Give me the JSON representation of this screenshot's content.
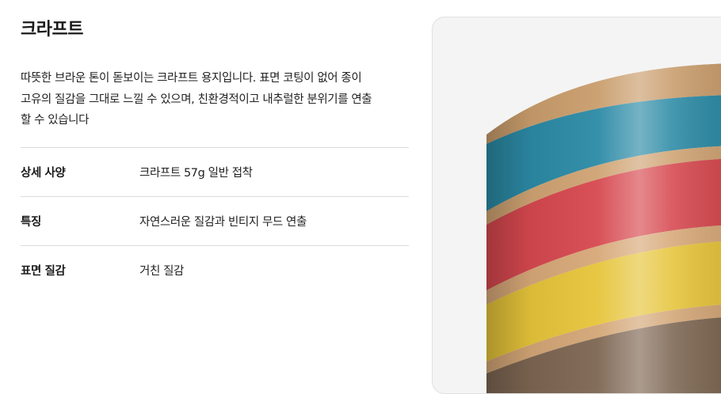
{
  "product": {
    "title": "크라프트",
    "description_lines": [
      "따뜻한 브라운 톤이 돋보이는 크라프트 용지입니다. 표면 코팅이 없어 종이",
      "고유의 질감을 그대로 느낄 수 있으며, 친환경적이고 내추럴한 분위기를 연출",
      "할 수 있습니다"
    ]
  },
  "specs": [
    {
      "label": "상세 사양",
      "value": "크라프트 57g 일반 접착"
    },
    {
      "label": "특징",
      "value": "자연스러운 질감과 빈티지 무드 연출"
    },
    {
      "label": "표면 질감",
      "value": "거친 질감"
    }
  ],
  "image": {
    "depicts": "kraft-tape-roll-photo",
    "band_colors": [
      "#c99d6c",
      "#2a8aa6",
      "#c99d6c",
      "#d44a4e",
      "#c99d6c",
      "#e8c53a",
      "#c99d6c",
      "#7a6450"
    ]
  }
}
